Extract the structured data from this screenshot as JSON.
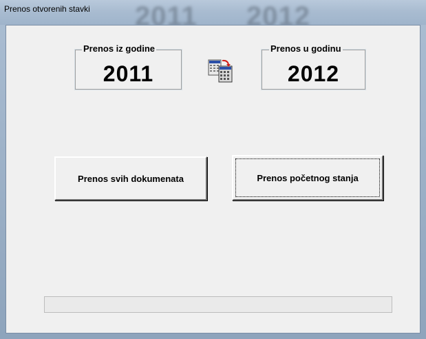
{
  "window": {
    "title": "Prenos otvorenih stavki",
    "title_background_years": [
      "2011",
      "2012"
    ]
  },
  "from_group": {
    "label": "Prenos iz godine",
    "year": "2011"
  },
  "to_group": {
    "label": "Prenos u godinu",
    "year": "2012"
  },
  "icons": {
    "transfer": "transfer-calculator-icon"
  },
  "buttons": {
    "transfer_all_label": "Prenos svih dokumenata",
    "transfer_initial_label": "Prenos početnog stanja",
    "focused": "transfer_initial"
  },
  "progress": {
    "value": 0
  },
  "colors": {
    "client_background": "#f0f0f0",
    "titlebar": "#a9bcd1",
    "progress_fill": "#4caf50"
  }
}
